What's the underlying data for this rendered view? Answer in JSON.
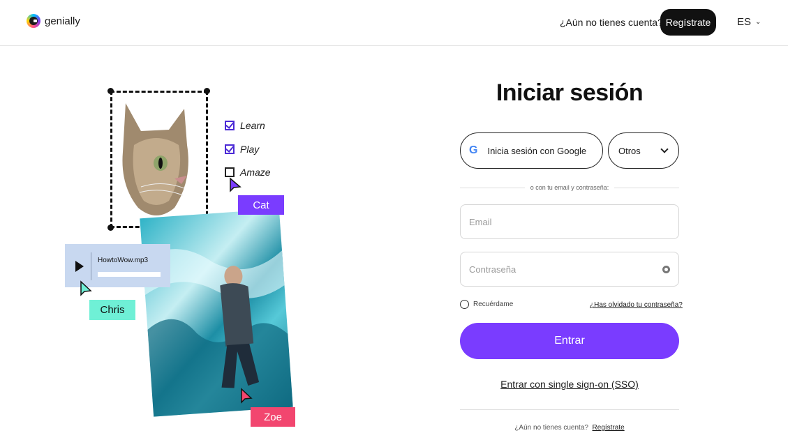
{
  "header": {
    "logo_text": "genially",
    "no_account": "¿Aún no tienes cuenta?",
    "register_label": "Regístrate",
    "language": "ES"
  },
  "illustration": {
    "checklist": [
      {
        "label": "Learn",
        "checked": true
      },
      {
        "label": "Play",
        "checked": true
      },
      {
        "label": "Amaze",
        "checked": false
      }
    ],
    "tags": {
      "cat": "Cat",
      "chris": "Chris",
      "zoe": "Zoe"
    },
    "audio_file": "HowtoWow.mp3"
  },
  "login": {
    "title": "Iniciar sesión",
    "google_label": "Inicia sesión con Google",
    "others_label": "Otros",
    "divider_text": "o con tu email y contraseña:",
    "email_placeholder": "Email",
    "password_placeholder": "Contraseña",
    "remember_label": "Recuérdame",
    "forgot_label": "¿Has olvidado tu contraseña?",
    "submit_label": "Entrar",
    "sso_label": "Entrar con single sign-on (SSO)",
    "bottom_question": "¿Aún no tienes cuenta?",
    "bottom_register": "Regístrate"
  },
  "colors": {
    "accent": "#7a3cff",
    "cat_tag": "#7a3cff",
    "chris_tag": "#6ff0d6",
    "zoe_tag": "#f2466f"
  }
}
